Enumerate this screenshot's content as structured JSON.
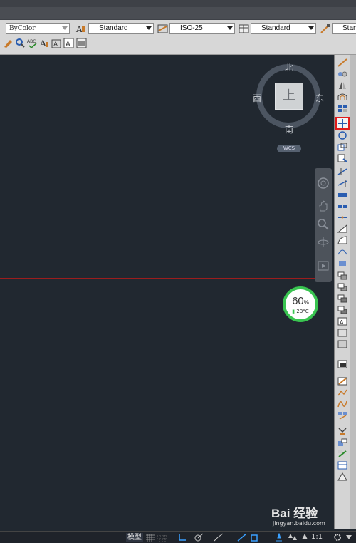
{
  "toolbar": {
    "color_combo": "ByColor",
    "text_style": "Standard",
    "dim_style": "ISO-25",
    "table_style": "Standard",
    "multileader_style": "Stan"
  },
  "viewcube": {
    "face_label": "上",
    "north": "北",
    "south": "南",
    "east": "东",
    "west": "西",
    "wcs_label": "WCS"
  },
  "gauge": {
    "percent": "60",
    "percent_sign": "%",
    "temperature": "23°C",
    "level": 0.6
  },
  "status": {
    "model_tab": "模型",
    "annotation_scale": "1:1"
  },
  "watermark": {
    "logo": "Bai 经验",
    "url": "jingyan.baidu.com"
  },
  "colors": {
    "canvas": "#212830",
    "accent_red_highlight": "#e11b1b",
    "gauge_green": "#39c450",
    "crosshair_red": "#9b1d1d"
  }
}
